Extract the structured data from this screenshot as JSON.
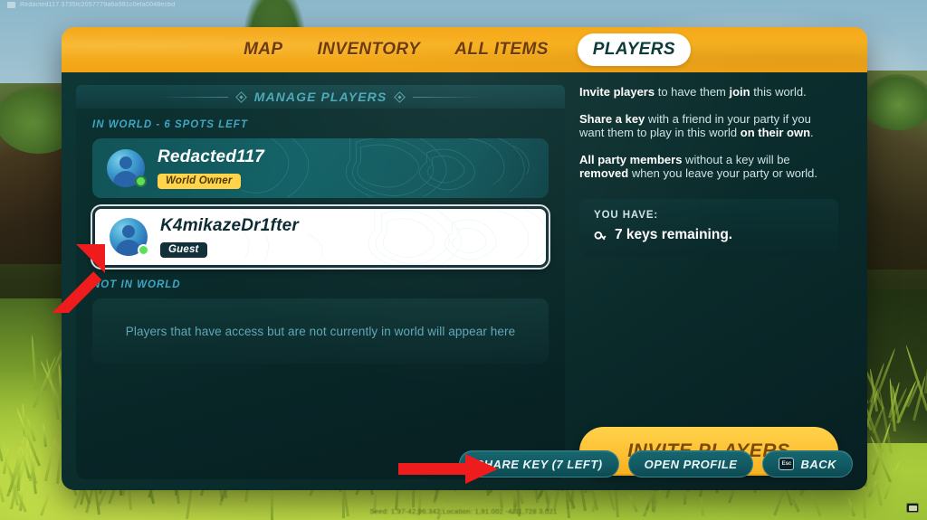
{
  "hud": {
    "top_left_text": "Redacted117  3735fc2057779a6a981c0efa0048ecbd",
    "bottom_text": "Seed: 1.97-42.96.342   Location: 1,91.002  -4.31,728  3.021"
  },
  "tabs": [
    {
      "label": "MAP",
      "active": false
    },
    {
      "label": "INVENTORY",
      "active": false
    },
    {
      "label": "ALL ITEMS",
      "active": false
    },
    {
      "label": "PLAYERS",
      "active": true
    }
  ],
  "manage": {
    "title": "MANAGE PLAYERS",
    "in_world_label": "IN WORLD - 6 SPOTS LEFT",
    "not_in_world_label": "NOT IN WORLD",
    "empty_state_text": "Players that have access but are not currently in world will appear here",
    "players": [
      {
        "name": "Redacted117",
        "badge": "World Owner",
        "badge_kind": "owner",
        "selected": false,
        "online": true
      },
      {
        "name": "K4mikazeDr1fter",
        "badge": "Guest",
        "badge_kind": "guest",
        "selected": true,
        "online": true
      }
    ]
  },
  "info": {
    "paragraphs": [
      [
        {
          "t": "Invite players",
          "b": true
        },
        {
          "t": " to have them ",
          "b": false
        },
        {
          "t": "join",
          "b": true
        },
        {
          "t": " this world.",
          "b": false
        }
      ],
      [
        {
          "t": "Share a key",
          "b": true
        },
        {
          "t": " with a friend in your party if you want them to play in this world ",
          "b": false
        },
        {
          "t": "on their own",
          "b": true
        },
        {
          "t": ".",
          "b": false
        }
      ],
      [
        {
          "t": "All party members",
          "b": true
        },
        {
          "t": " without a key will be ",
          "b": false
        },
        {
          "t": "removed",
          "b": true
        },
        {
          "t": " when you leave your party or world.",
          "b": false
        }
      ]
    ]
  },
  "keys": {
    "label": "YOU HAVE:",
    "value": "7 keys remaining.",
    "icon": "key-icon"
  },
  "invite_button": {
    "label": "INVITE PLAYERS"
  },
  "footer_buttons": [
    {
      "label": "SHARE KEY (7 LEFT)",
      "key_hint": ""
    },
    {
      "label": "OPEN PROFILE",
      "key_hint": ""
    },
    {
      "label": "BACK",
      "key_hint": "Esc"
    }
  ],
  "colors": {
    "accent_yellow": "#f7b11f",
    "panel_teal": "#0b3130",
    "badge_owner": "#ffd34a",
    "badge_guest": "#11303a",
    "online_green": "#5ce05c",
    "annotation_red": "#ee1c1c",
    "tab_active_bg": "#ffffff",
    "tab_active_text": "#0c3b3a"
  }
}
